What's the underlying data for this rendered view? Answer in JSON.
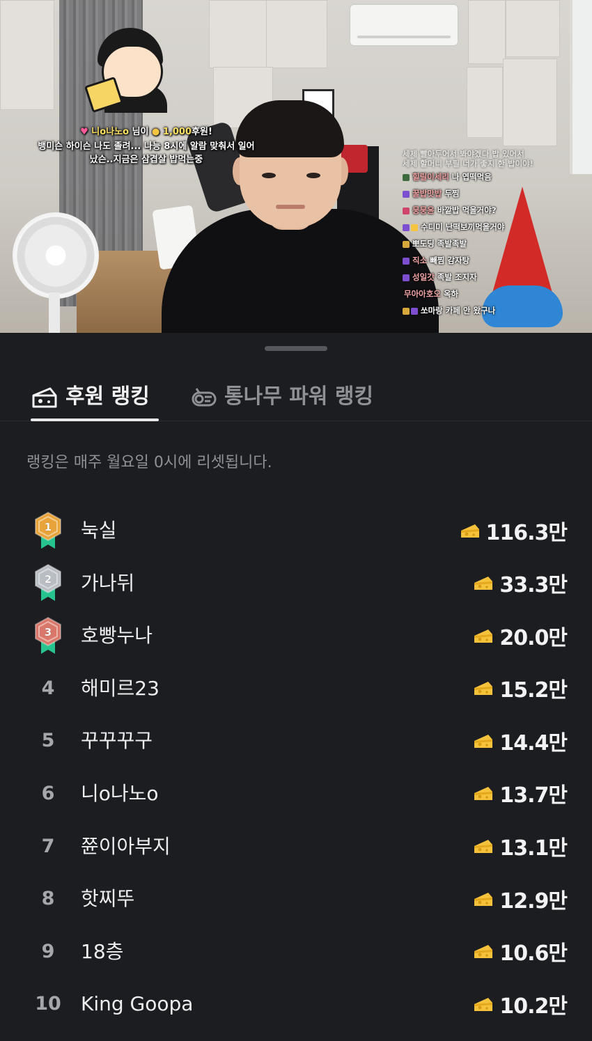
{
  "stream_overlay": {
    "donation_line": {
      "nickname": "니o나노o",
      "suffix": "님이",
      "amount": "1,000",
      "action": "후원!"
    },
    "donation_message_line1": "뱅미슨 하이슨 나도 졸려... 나능 8시에 알람 맞춰서 일어",
    "donation_message_line2": "났슨..지금은 삼겹살 밥먹는중",
    "chat_faded": [
      "세제 빨아두어서 봐야겠다 밥 있어서",
      "세제 할머니 부필 너가 좋지 한 밥이야!"
    ],
    "chat": [
      {
        "nick": "힐릴이세리",
        "msg": "나 엽떡먹음",
        "nick_color": "#f3a5a5"
      },
      {
        "nick": "꿀밥맛밥",
        "msg": "두찜",
        "nick_color": "#f3a5a5"
      },
      {
        "nick": "뭉뭉윤",
        "msg": "바깥밥 먹을거야?",
        "nick_color": "#f3a5a5"
      },
      {
        "nick": "수디미",
        "msg": "난떡보끼먹을거야",
        "nick_color": "#ffffff"
      },
      {
        "nick": "뽀도딩",
        "msg": "족발족발",
        "nick_color": "#ffffff"
      },
      {
        "nick": "직소",
        "msg": "빼찜 감자탕",
        "nick_color": "#f3a5a5"
      },
      {
        "nick": "성일갓",
        "msg": "족발 조지자",
        "nick_color": "#f3a5a5"
      },
      {
        "nick": "무아아호오",
        "msg": "옥하",
        "nick_color": "#f3a5a5"
      },
      {
        "nick": "쏘마랑",
        "msg": "카페 안 왔구나",
        "nick_color": "#ffffff"
      }
    ]
  },
  "tabs": [
    {
      "label": "후원 랭킹",
      "icon": "cheese-icon",
      "active": true
    },
    {
      "label": "통나무 파워 랭킹",
      "icon": "log-icon",
      "active": false
    }
  ],
  "notice": "랭킹은 매주 월요일 0시에 리셋됩니다.",
  "medal_colors": {
    "gold": "#e8a43a",
    "silver": "#b9bdc4",
    "bronze": "#d9786a",
    "ribbon": "#27c38e"
  },
  "ranking": [
    {
      "rank": "1",
      "name": "눅실",
      "amount": "116.3만"
    },
    {
      "rank": "2",
      "name": "가나뒤",
      "amount": "33.3만"
    },
    {
      "rank": "3",
      "name": "호빵누나",
      "amount": "20.0만"
    },
    {
      "rank": "4",
      "name": "해미르23",
      "amount": "15.2만"
    },
    {
      "rank": "5",
      "name": "꾸꾸꾸구",
      "amount": "14.4만"
    },
    {
      "rank": "6",
      "name": "니o나노o",
      "amount": "13.7만"
    },
    {
      "rank": "7",
      "name": "쮼이아부지",
      "amount": "13.1만"
    },
    {
      "rank": "8",
      "name": "핫찌뚜",
      "amount": "12.9만"
    },
    {
      "rank": "9",
      "name": "18층",
      "amount": "10.6만"
    },
    {
      "rank": "10",
      "name": "King Goopa",
      "amount": "10.2만"
    }
  ]
}
